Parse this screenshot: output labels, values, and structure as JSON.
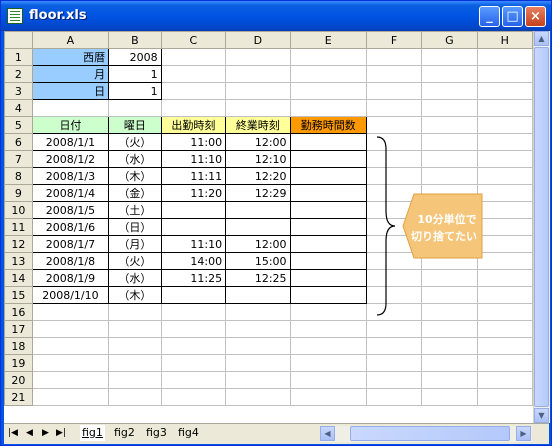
{
  "window": {
    "title": "floor.xls"
  },
  "columns": [
    "A",
    "B",
    "C",
    "D",
    "E",
    "F",
    "G",
    "H"
  ],
  "rows": [
    "1",
    "2",
    "3",
    "4",
    "5",
    "6",
    "7",
    "8",
    "9",
    "10",
    "11",
    "12",
    "13",
    "14",
    "15",
    "16",
    "17",
    "18",
    "19",
    "20",
    "21"
  ],
  "params": [
    {
      "label": "西暦",
      "value": "2008"
    },
    {
      "label": "月",
      "value": "1"
    },
    {
      "label": "日",
      "value": "1"
    }
  ],
  "table_headers": [
    "日付",
    "曜日",
    "出勤時刻",
    "終業時刻",
    "勤務時間数"
  ],
  "records": [
    {
      "date": "2008/1/1",
      "dow": "（火）",
      "start": "11:00",
      "end": "12:00"
    },
    {
      "date": "2008/1/2",
      "dow": "（水）",
      "start": "11:10",
      "end": "12:10"
    },
    {
      "date": "2008/1/3",
      "dow": "（木）",
      "start": "11:11",
      "end": "12:20"
    },
    {
      "date": "2008/1/4",
      "dow": "（金）",
      "start": "11:20",
      "end": "12:29"
    },
    {
      "date": "2008/1/5",
      "dow": "（土）",
      "start": "",
      "end": ""
    },
    {
      "date": "2008/1/6",
      "dow": "（日）",
      "start": "",
      "end": ""
    },
    {
      "date": "2008/1/7",
      "dow": "（月）",
      "start": "11:10",
      "end": "12:00"
    },
    {
      "date": "2008/1/8",
      "dow": "（火）",
      "start": "14:00",
      "end": "15:00"
    },
    {
      "date": "2008/1/9",
      "dow": "（水）",
      "start": "11:25",
      "end": "12:25"
    },
    {
      "date": "2008/1/10",
      "dow": "（木）",
      "start": "",
      "end": ""
    }
  ],
  "callout": {
    "line1": "10分単位で",
    "line2": "切り捨てたい",
    "color": "#f5c57a"
  },
  "sheet_tabs": [
    "fig1",
    "fig2",
    "fig3",
    "fig4"
  ],
  "colors": {
    "header_bg": "#ece9d8",
    "blue": "#99ccff",
    "green": "#ccffcc",
    "yellow": "#ffff99",
    "orange": "#ff9900"
  }
}
